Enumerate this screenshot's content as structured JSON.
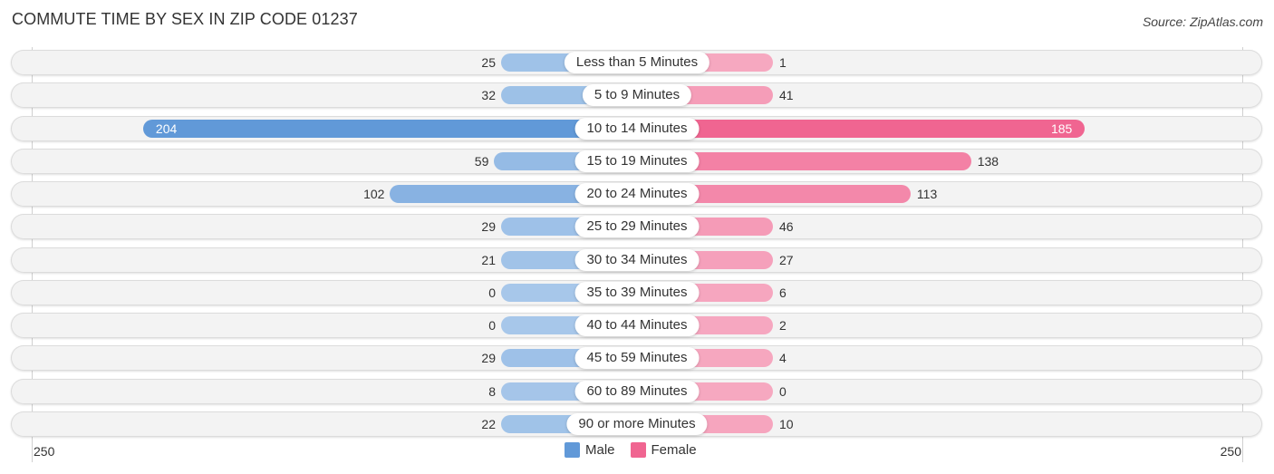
{
  "header": {
    "title": "COMMUTE TIME BY SEX IN ZIP CODE 01237",
    "source": "Source: ZipAtlas.com"
  },
  "colors": {
    "male_dark": "#6199d8",
    "male_light": "#a7c7ea",
    "female_dark": "#f06591",
    "female_light": "#f6a8c0",
    "row_bg": "#f3f3f3"
  },
  "legend": [
    {
      "label": "Male",
      "color": "#6199d8"
    },
    {
      "label": "Female",
      "color": "#f06591"
    }
  ],
  "chart_data": {
    "type": "bar",
    "orientation": "horizontal-diverging",
    "title": "COMMUTE TIME BY SEX IN ZIP CODE 01237",
    "source": "Source: ZipAtlas.com",
    "categories": [
      "Less than 5 Minutes",
      "5 to 9 Minutes",
      "10 to 14 Minutes",
      "15 to 19 Minutes",
      "20 to 24 Minutes",
      "25 to 29 Minutes",
      "30 to 34 Minutes",
      "35 to 39 Minutes",
      "40 to 44 Minutes",
      "45 to 59 Minutes",
      "60 to 89 Minutes",
      "90 or more Minutes"
    ],
    "series": [
      {
        "name": "Male",
        "side": "left",
        "values": [
          25,
          32,
          204,
          59,
          102,
          29,
          21,
          0,
          0,
          29,
          8,
          22
        ]
      },
      {
        "name": "Female",
        "side": "right",
        "values": [
          1,
          41,
          185,
          138,
          113,
          46,
          27,
          6,
          2,
          4,
          0,
          10
        ]
      }
    ],
    "axis": {
      "left_max": 250,
      "right_max": 250,
      "left_label": "250",
      "right_label": "250"
    },
    "legend_position": "bottom-center",
    "grid": false
  }
}
